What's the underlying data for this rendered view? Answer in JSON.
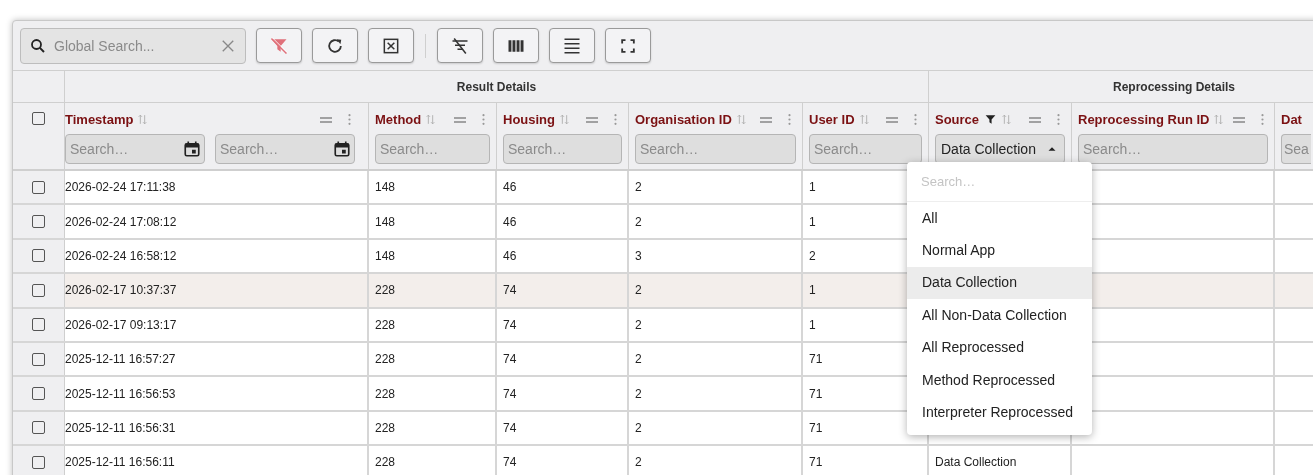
{
  "toolbar": {
    "search": {
      "placeholder": "Global Search..."
    }
  },
  "groups": [
    {
      "label": "Result Details"
    },
    {
      "label": "Reprocessing Details"
    }
  ],
  "columns": [
    {
      "label": "Timestamp",
      "kind": "date-range",
      "filtered": false,
      "placeholders": [
        "Search…",
        "Search…"
      ]
    },
    {
      "label": "Method",
      "kind": "text",
      "filtered": false,
      "placeholders": [
        "Search…"
      ]
    },
    {
      "label": "Housing",
      "kind": "text",
      "filtered": false,
      "placeholders": [
        "Search…"
      ]
    },
    {
      "label": "Organisation ID",
      "kind": "text",
      "filtered": false,
      "placeholders": [
        "Search…"
      ]
    },
    {
      "label": "User ID",
      "kind": "text",
      "filtered": false,
      "placeholders": [
        "Search…"
      ]
    },
    {
      "label": "Source",
      "kind": "select",
      "filtered": true,
      "value": "Data Collection"
    },
    {
      "label": "Reprocessing Run ID",
      "kind": "text",
      "filtered": false,
      "placeholders": [
        "Search…"
      ]
    },
    {
      "label": "Dat",
      "kind": "text",
      "filtered": false,
      "placeholders": [
        "Sea"
      ]
    }
  ],
  "select_all_checked": false,
  "rows": [
    {
      "checked": false,
      "hovered": false,
      "cells": [
        "2026-02-24 17:11:38",
        "148",
        "46",
        "2",
        "1"
      ]
    },
    {
      "checked": false,
      "hovered": false,
      "cells": [
        "2026-02-24 17:08:12",
        "148",
        "46",
        "2",
        "1"
      ]
    },
    {
      "checked": false,
      "hovered": false,
      "cells": [
        "2026-02-24 16:58:12",
        "148",
        "46",
        "3",
        "2"
      ]
    },
    {
      "checked": false,
      "hovered": true,
      "cells": [
        "2026-02-17 10:37:37",
        "228",
        "74",
        "2",
        "1"
      ]
    },
    {
      "checked": false,
      "hovered": false,
      "cells": [
        "2026-02-17 09:13:17",
        "228",
        "74",
        "2",
        "1"
      ]
    },
    {
      "checked": false,
      "hovered": false,
      "cells": [
        "2025-12-11 16:57:27",
        "228",
        "74",
        "2",
        "71"
      ]
    },
    {
      "checked": false,
      "hovered": false,
      "cells": [
        "2025-12-11 16:56:53",
        "228",
        "74",
        "2",
        "71"
      ]
    },
    {
      "checked": false,
      "hovered": false,
      "cells": [
        "2025-12-11 16:56:31",
        "228",
        "74",
        "2",
        "71"
      ]
    },
    {
      "checked": false,
      "hovered": false,
      "cells": [
        "2025-12-11 16:56:11",
        "228",
        "74",
        "2",
        "71",
        "Data Collection"
      ]
    }
  ],
  "dropdown": {
    "search_placeholder": "Search…",
    "options": [
      {
        "label": "All",
        "selected": false
      },
      {
        "label": "Normal App",
        "selected": false
      },
      {
        "label": "Data Collection",
        "selected": true
      },
      {
        "label": "All Non-Data Collection",
        "selected": false
      },
      {
        "label": "All Reprocessed",
        "selected": false
      },
      {
        "label": "Method Reprocessed",
        "selected": false
      },
      {
        "label": "Interpreter Reprocessed",
        "selected": false
      }
    ]
  }
}
